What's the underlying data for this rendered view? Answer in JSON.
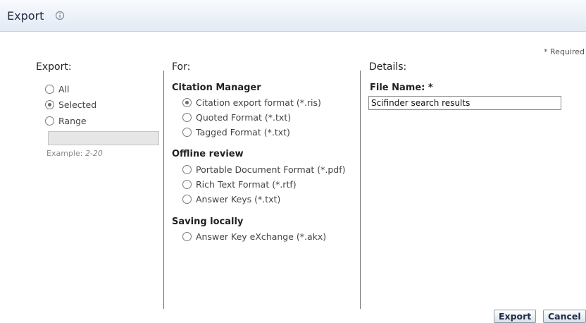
{
  "dialog": {
    "title": "Export",
    "title_icon": "info-icon",
    "required_note": "* Required"
  },
  "export_section": {
    "heading": "Export:",
    "options": [
      {
        "label": "All",
        "checked": false
      },
      {
        "label": "Selected",
        "checked": true
      },
      {
        "label": "Range",
        "checked": false
      }
    ],
    "range_value": "",
    "example_prefix": "Example:",
    "example_value": "2-20"
  },
  "for_section": {
    "heading": "For:",
    "groups": [
      {
        "title": "Citation Manager",
        "options": [
          {
            "label": "Citation export format (*.ris)",
            "checked": true
          },
          {
            "label": "Quoted Format (*.txt)",
            "checked": false
          },
          {
            "label": "Tagged Format (*.txt)",
            "checked": false
          }
        ]
      },
      {
        "title": "Offline review",
        "options": [
          {
            "label": "Portable Document Format (*.pdf)",
            "checked": false
          },
          {
            "label": "Rich Text Format (*.rtf)",
            "checked": false
          },
          {
            "label": "Answer Keys (*.txt)",
            "checked": false
          }
        ]
      },
      {
        "title": "Saving locally",
        "options": [
          {
            "label": "Answer Key eXchange (*.akx)",
            "checked": false
          }
        ]
      }
    ]
  },
  "details_section": {
    "heading": "Details:",
    "file_name_label": "File Name: *",
    "file_name_value": "Scifinder search results"
  },
  "buttons": {
    "export": "Export",
    "cancel": "Cancel"
  }
}
